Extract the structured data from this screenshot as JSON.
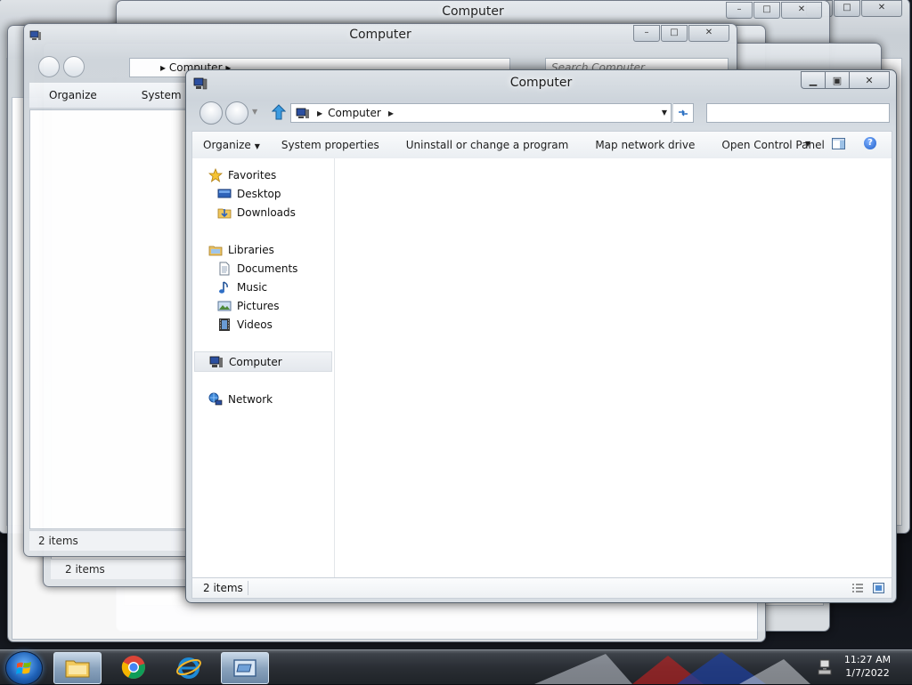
{
  "window": {
    "title": "Computer",
    "address": {
      "crumb": "Computer"
    },
    "toolbar": {
      "organize": "Organize",
      "system_properties": "System properties",
      "uninstall": "Uninstall or change a program",
      "map_drive": "Map network drive",
      "control_panel": "Open Control Panel"
    },
    "nav": {
      "favorites": "Favorites",
      "desktop": "Desktop",
      "downloads": "Downloads",
      "libraries": "Libraries",
      "documents": "Documents",
      "music": "Music",
      "pictures": "Pictures",
      "videos": "Videos",
      "computer": "Computer",
      "network": "Network"
    },
    "status": {
      "items": "2 items"
    }
  },
  "ghosts": {
    "title": "Computer",
    "search_placeholder": "Search Computer",
    "organize": "Organize",
    "system": "System",
    "items": "2 items",
    "crumb": "Computer"
  },
  "taskbar": {
    "time": "11:27 AM",
    "date": "1/7/2022"
  },
  "colors": {
    "accent": "#1f62b8",
    "taskbar": "#2a2e34",
    "window_frame": "#cdd4db"
  }
}
